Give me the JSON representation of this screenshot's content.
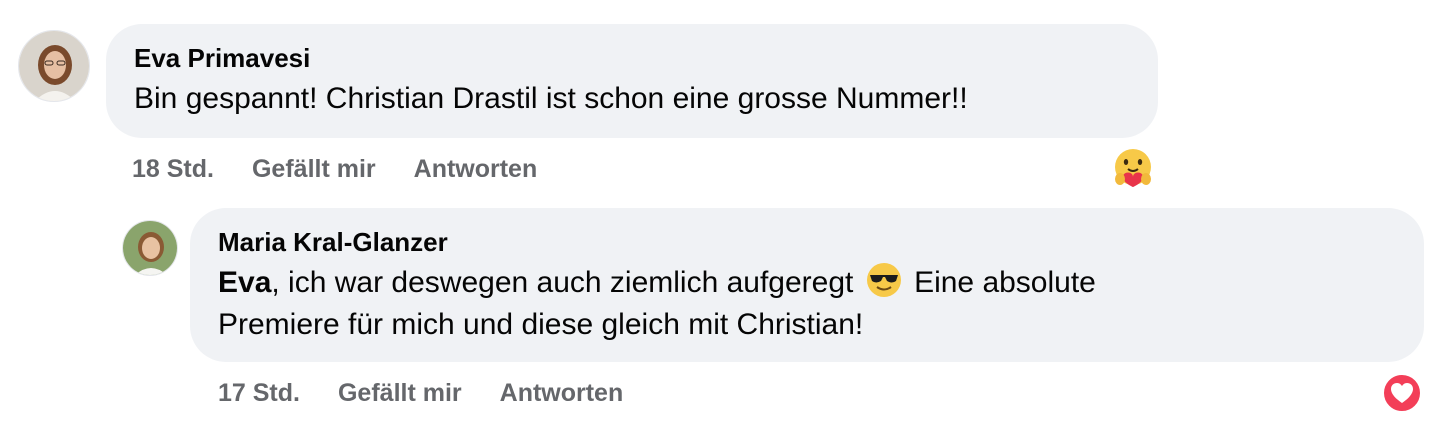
{
  "comments": [
    {
      "author": "Eva Primavesi",
      "text": "Bin gespannt! Christian Drastil ist schon eine grosse Nummer!!",
      "time": "18 Std.",
      "like_label": "Gefällt mir",
      "reply_label": "Antworten",
      "reaction_icon": "care-hug-emoji"
    }
  ],
  "reply": {
    "author": "Maria Kral-Glanzer",
    "mention": "Eva",
    "text_part1": ", ich war deswegen auch ziemlich aufgeregt",
    "inline_emoji": "sunglasses-emoji",
    "text_part2": "Eine absolute",
    "text_line2": "Premiere für mich und diese gleich mit Christian!",
    "time": "17 Std.",
    "like_label": "Gefällt mir",
    "reply_label": "Antworten",
    "reaction_icon": "love-heart-reaction",
    "reaction_color": "#f33e58"
  },
  "colors": {
    "bubble": "#f0f2f5",
    "meta_text": "#65676b",
    "text": "#050505"
  }
}
